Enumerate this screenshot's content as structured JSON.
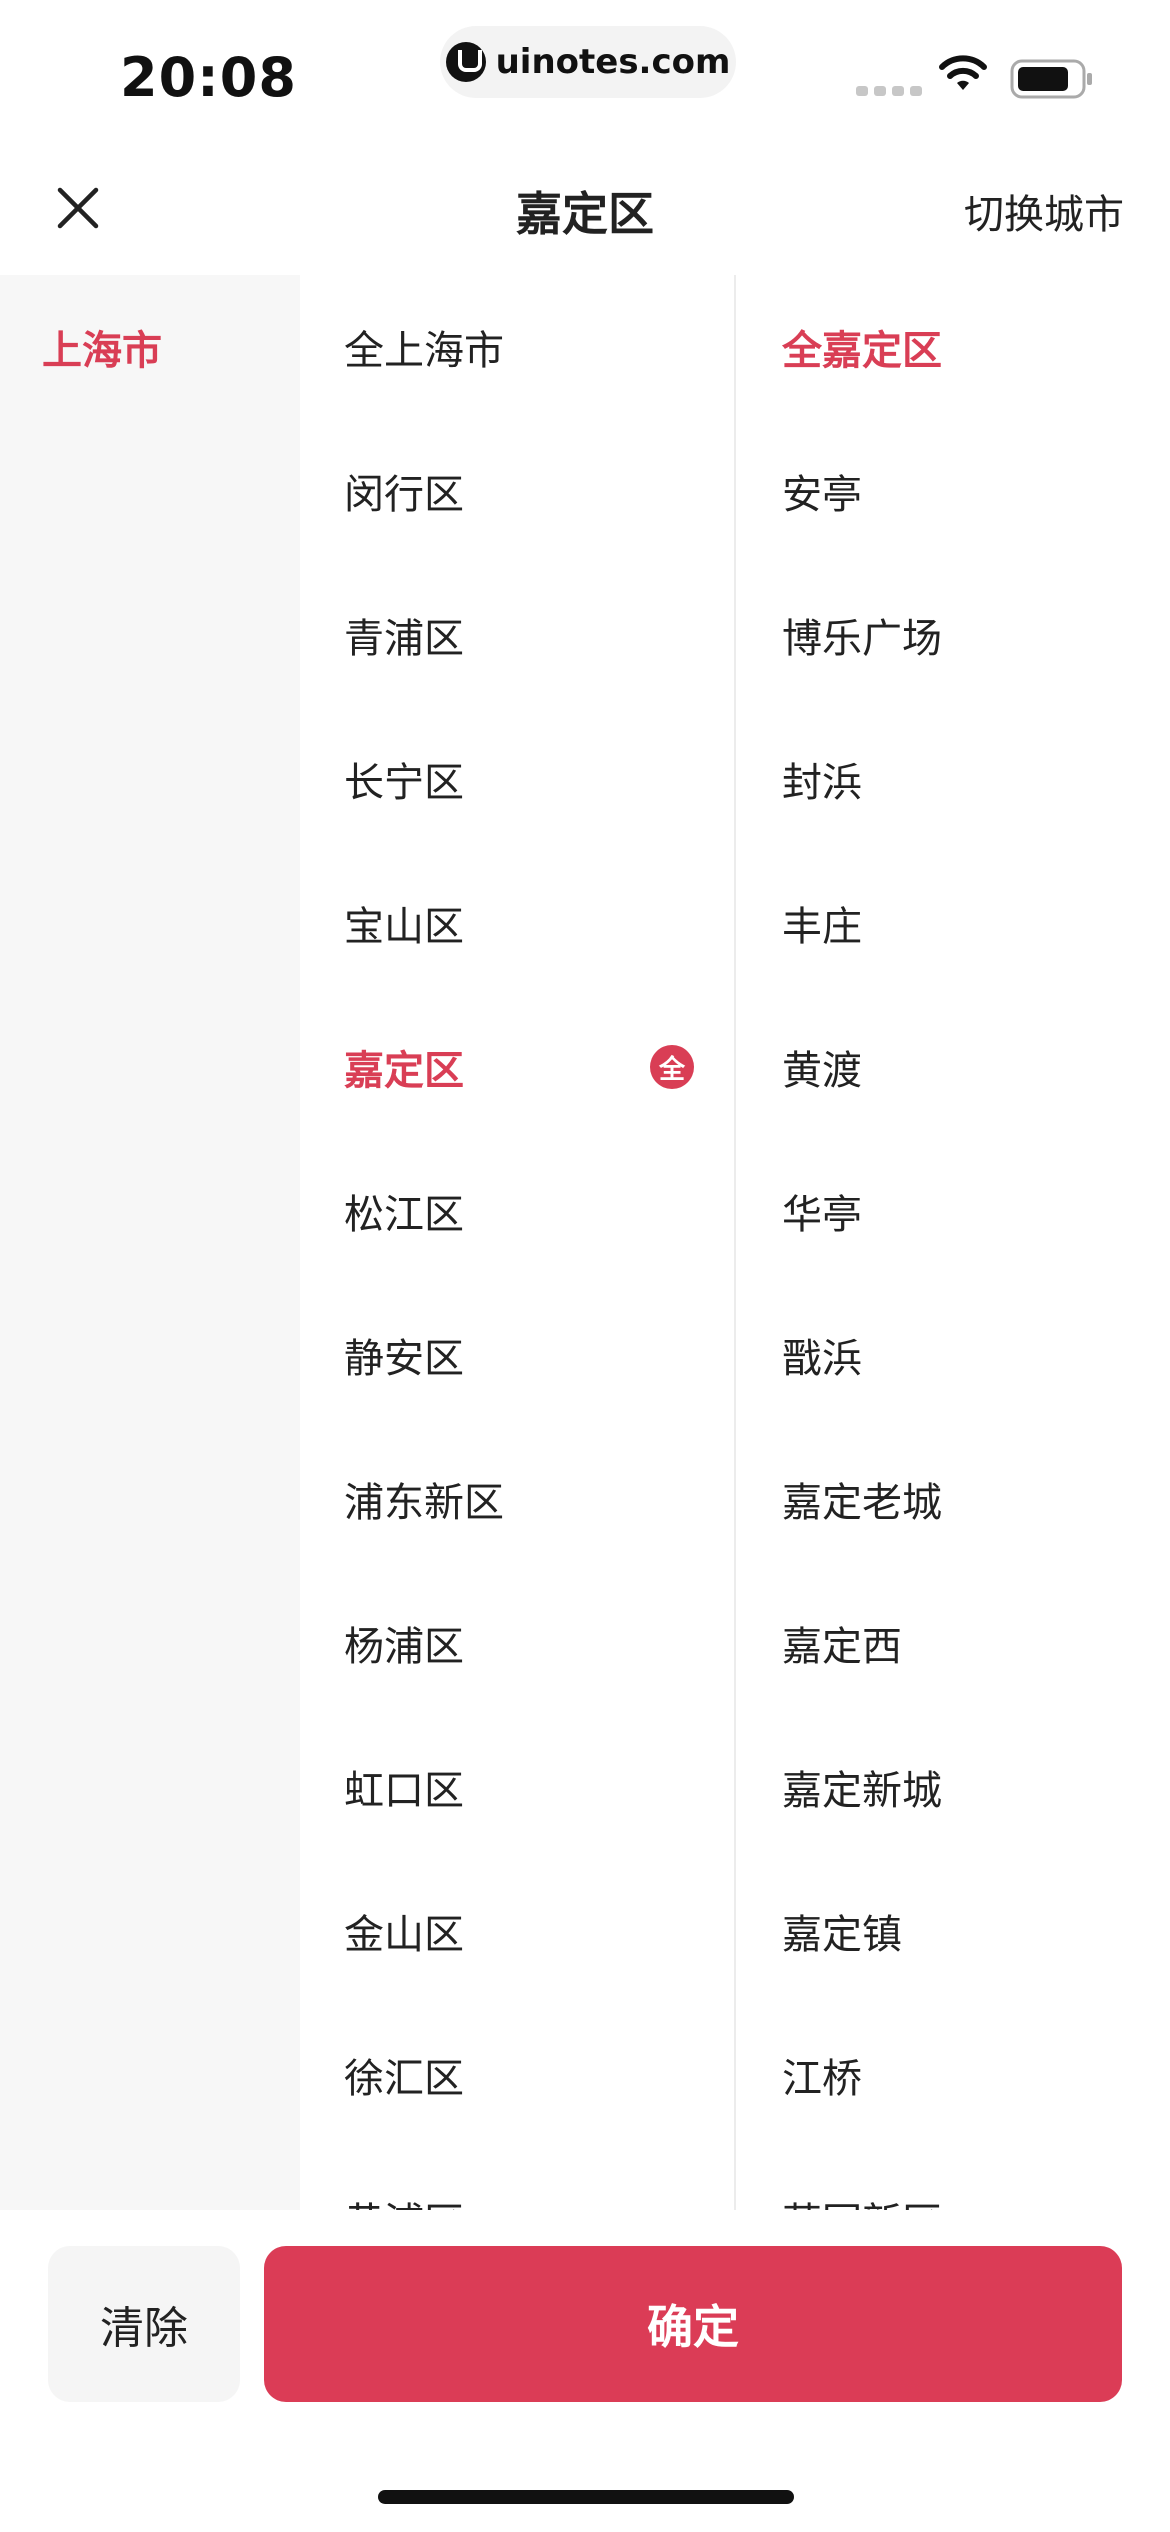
{
  "status_bar": {
    "time": "20:08",
    "url": "uinotes.com"
  },
  "header": {
    "title": "嘉定区",
    "switch_city": "切换城市"
  },
  "cities": [
    {
      "label": "上海市",
      "active": true
    }
  ],
  "districts": [
    {
      "label": "全上海市",
      "active": false
    },
    {
      "label": "闵行区",
      "active": false
    },
    {
      "label": "青浦区",
      "active": false
    },
    {
      "label": "长宁区",
      "active": false
    },
    {
      "label": "宝山区",
      "active": false
    },
    {
      "label": "嘉定区",
      "active": true,
      "badge": "全"
    },
    {
      "label": "松江区",
      "active": false
    },
    {
      "label": "静安区",
      "active": false
    },
    {
      "label": "浦东新区",
      "active": false
    },
    {
      "label": "杨浦区",
      "active": false
    },
    {
      "label": "虹口区",
      "active": false
    },
    {
      "label": "金山区",
      "active": false
    },
    {
      "label": "徐汇区",
      "active": false
    },
    {
      "label": "黄浦区",
      "active": false
    }
  ],
  "areas": [
    {
      "label": "全嘉定区",
      "active": true
    },
    {
      "label": "安亭",
      "active": false
    },
    {
      "label": "博乐广场",
      "active": false
    },
    {
      "label": "封浜",
      "active": false
    },
    {
      "label": "丰庄",
      "active": false
    },
    {
      "label": "黄渡",
      "active": false
    },
    {
      "label": "华亭",
      "active": false
    },
    {
      "label": "戬浜",
      "active": false
    },
    {
      "label": "嘉定老城",
      "active": false
    },
    {
      "label": "嘉定西",
      "active": false
    },
    {
      "label": "嘉定新城",
      "active": false
    },
    {
      "label": "嘉定镇",
      "active": false
    },
    {
      "label": "江桥",
      "active": false
    },
    {
      "label": "菊园新区",
      "active": false
    }
  ],
  "footer": {
    "clear_label": "清除",
    "confirm_label": "确定"
  },
  "colors": {
    "accent": "#db3c56",
    "sidebar_bg": "#f7f7f7"
  },
  "icons": {
    "close": "close-icon",
    "wifi": "wifi-icon",
    "battery": "battery-icon",
    "signal": "signal-icon"
  }
}
